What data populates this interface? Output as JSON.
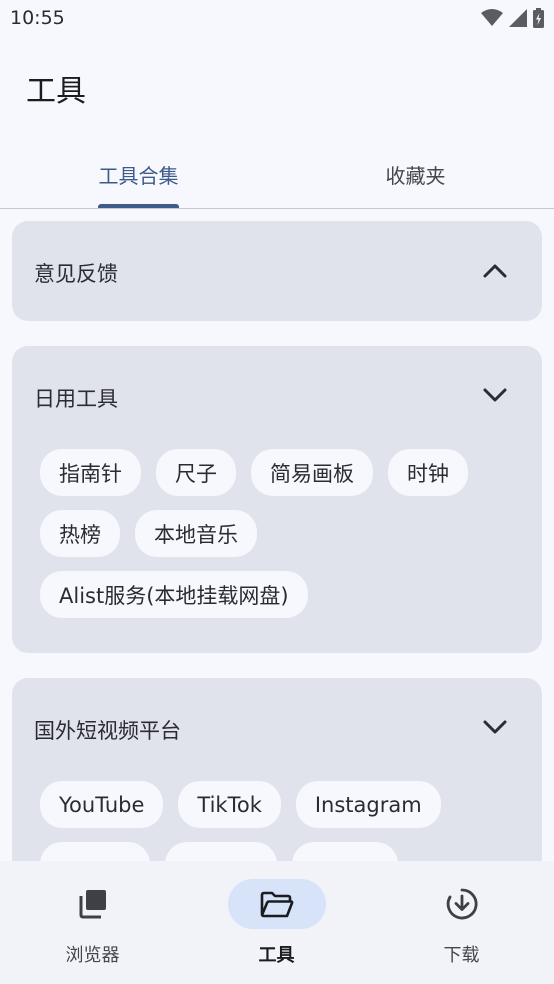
{
  "status_bar": {
    "time": "10:55",
    "icons": [
      "wifi-icon",
      "signal-icon",
      "battery-icon"
    ]
  },
  "header": {
    "title": "工具"
  },
  "tabs": [
    {
      "label": "工具合集",
      "selected": true
    },
    {
      "label": "收藏夹",
      "selected": false
    }
  ],
  "sections": [
    {
      "title": "意见反馈",
      "expanded": false,
      "chevron": "chevron-up-icon",
      "chips": []
    },
    {
      "title": "日用工具",
      "expanded": true,
      "chevron": "chevron-down-icon",
      "chips": [
        "指南针",
        "尺子",
        "简易画板",
        "时钟",
        "热榜",
        "本地音乐",
        "Alist服务(本地挂载网盘)"
      ]
    },
    {
      "title": "国外短视频平台",
      "expanded": true,
      "chevron": "chevron-down-icon",
      "chips": [
        "YouTube",
        "TikTok",
        "Instagram",
        "",
        "",
        ""
      ]
    }
  ],
  "bottom_nav": [
    {
      "label": "浏览器",
      "icon": "tabs-icon",
      "selected": false
    },
    {
      "label": "工具",
      "icon": "folder-open-icon",
      "selected": true
    },
    {
      "label": "下载",
      "icon": "download-circle-icon",
      "selected": false
    }
  ],
  "colors": {
    "accent": "#3d5a8a",
    "card": "#e0e2ec",
    "chip": "#f7f8fd",
    "nav_pill": "#d6e3f8",
    "background": "#f7f8fd"
  }
}
